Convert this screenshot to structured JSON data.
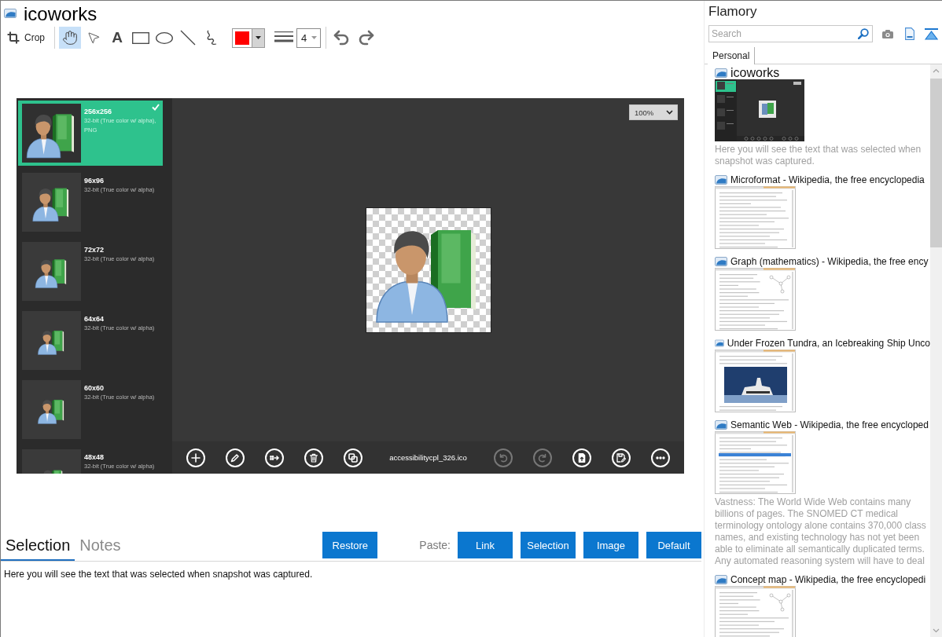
{
  "window": {
    "title": "icoworks"
  },
  "toolbar": {
    "crop": {
      "label": "Crop"
    },
    "tools": [
      {
        "kind": "hand",
        "selected": true
      },
      {
        "kind": "pointer",
        "selected": false
      },
      {
        "kind": "text",
        "glyph": "A",
        "selected": false
      },
      {
        "kind": "rectangle",
        "selected": false
      },
      {
        "kind": "ellipse",
        "selected": false
      },
      {
        "kind": "line",
        "selected": false
      },
      {
        "kind": "freehand",
        "selected": false
      }
    ],
    "color_picker": {
      "color": "#ff0000"
    },
    "line_width": {
      "value": "4"
    }
  },
  "screenshot": {
    "sizes": [
      {
        "size": "256x256",
        "format": "32-bit (True color w/ alpha), PNG",
        "selected": true
      },
      {
        "size": "96x96",
        "format": "32-bit (True color w/ alpha)",
        "selected": false
      },
      {
        "size": "72x72",
        "format": "32-bit (True color w/ alpha)",
        "selected": false
      },
      {
        "size": "64x64",
        "format": "32-bit (True color w/ alpha)",
        "selected": false
      },
      {
        "size": "60x60",
        "format": "32-bit (True color w/ alpha)",
        "selected": false
      },
      {
        "size": "48x48",
        "format": "32-bit (True color w/ alpha)",
        "selected": false
      }
    ],
    "zoom": "100%",
    "actions_left": [
      {
        "kind": "add",
        "disabled": false
      },
      {
        "kind": "edit",
        "disabled": false
      },
      {
        "kind": "export",
        "disabled": false
      },
      {
        "kind": "delete",
        "disabled": false
      },
      {
        "kind": "duplicate",
        "disabled": false
      }
    ],
    "file_name": "accessibilitycpl_326.ico",
    "actions_right": [
      {
        "kind": "undo",
        "disabled": true
      },
      {
        "kind": "redo",
        "disabled": true
      },
      {
        "kind": "import",
        "disabled": false
      },
      {
        "kind": "save_as",
        "disabled": false
      },
      {
        "kind": "more",
        "disabled": false
      }
    ]
  },
  "notes_panel": {
    "tabs": [
      {
        "label": "Selection",
        "selected": true
      },
      {
        "label": "Notes",
        "selected": false
      }
    ],
    "restore_button": "Restore",
    "paste_label": "Paste:",
    "paste_buttons": [
      "Link",
      "Selection",
      "Image",
      "Default"
    ],
    "text": "Here you will see the text that was selected when snapshot was captured."
  },
  "sidebar": {
    "title": "Flamory",
    "search": {
      "placeholder": "Search"
    },
    "tabs": [
      {
        "label": "Personal",
        "selected": true
      }
    ],
    "snapshots": [
      {
        "title": "icoworks",
        "current": true,
        "kind": "app",
        "note": "Here you will see the text that was selected when snapshot was captured."
      },
      {
        "title": "Microformat - Wikipedia, the free encyclopedia",
        "current": false,
        "kind": "article"
      },
      {
        "title": "Graph (mathematics) - Wikipedia, the free ency",
        "current": false,
        "kind": "article_figure"
      },
      {
        "title": "Under Frozen Tundra, an Icebreaking Ship Unco",
        "current": false,
        "kind": "article_photo"
      },
      {
        "title": "Semantic Web - Wikipedia, the free encycloped",
        "current": false,
        "kind": "article_highlight",
        "note": "Vastness: The World Wide Web contains many billions of pages. The SNOMED CT medical terminology ontology alone contains 370,000 class names, and existing technology has not yet been able to eliminate all semantically duplicated terms. Any automated reasoning system will have to deal"
      },
      {
        "title": "Concept map - Wikipedia, the free encyclopedi",
        "current": false,
        "kind": "article_figure"
      }
    ]
  }
}
